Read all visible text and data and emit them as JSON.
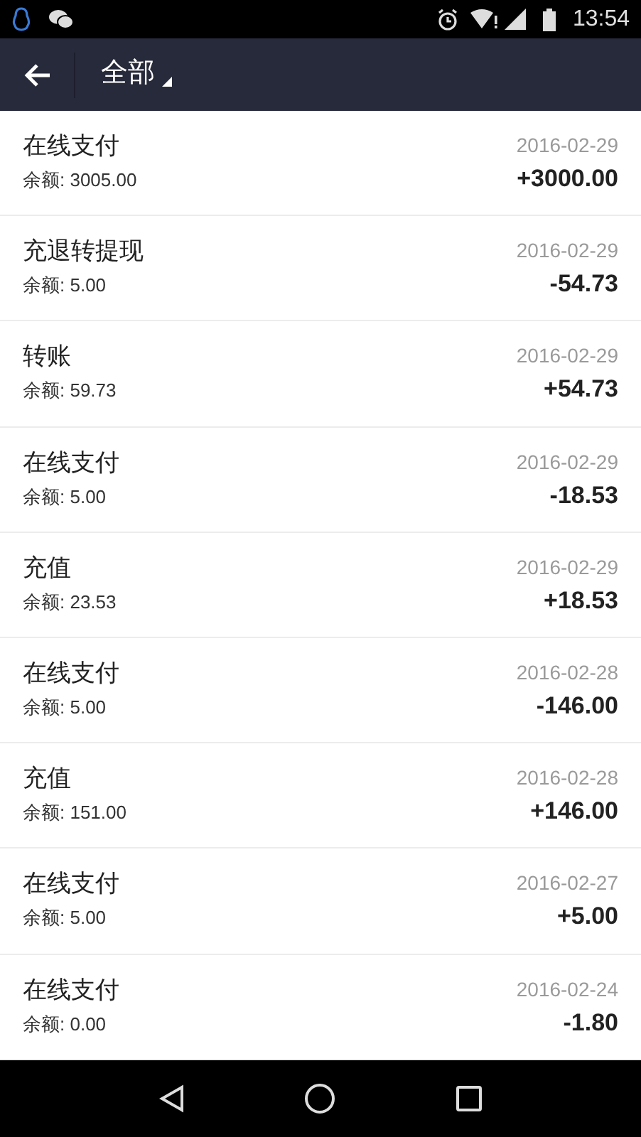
{
  "status_bar": {
    "time": "13:54"
  },
  "header": {
    "title": "全部"
  },
  "transactions": [
    {
      "type": "在线支付",
      "balance": "余额: 3005.00",
      "date": "2016-02-29",
      "amount": "+3000.00"
    },
    {
      "type": "充退转提现",
      "balance": "余额: 5.00",
      "date": "2016-02-29",
      "amount": "-54.73"
    },
    {
      "type": "转账",
      "balance": "余额: 59.73",
      "date": "2016-02-29",
      "amount": "+54.73"
    },
    {
      "type": "在线支付",
      "balance": "余额: 5.00",
      "date": "2016-02-29",
      "amount": "-18.53"
    },
    {
      "type": "充值",
      "balance": "余额: 23.53",
      "date": "2016-02-29",
      "amount": "+18.53"
    },
    {
      "type": "在线支付",
      "balance": "余额: 5.00",
      "date": "2016-02-28",
      "amount": "-146.00"
    },
    {
      "type": "充值",
      "balance": "余额: 151.00",
      "date": "2016-02-28",
      "amount": "+146.00"
    },
    {
      "type": "在线支付",
      "balance": "余额: 5.00",
      "date": "2016-02-27",
      "amount": "+5.00"
    },
    {
      "type": "在线支付",
      "balance": "余额: 0.00",
      "date": "2016-02-24",
      "amount": "-1.80"
    }
  ]
}
